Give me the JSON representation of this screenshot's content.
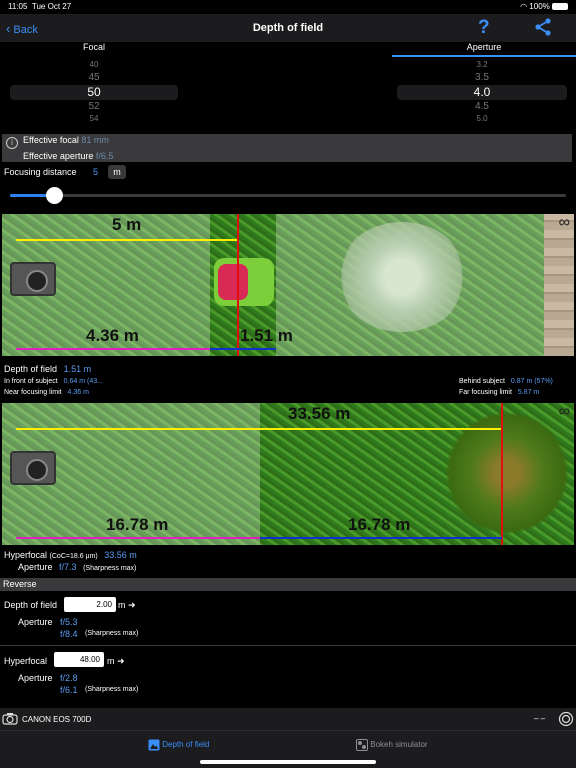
{
  "status": {
    "time": "11:05",
    "date": "Tue Oct 27",
    "battery": "100%"
  },
  "nav": {
    "back_label": "Back",
    "title": "Depth of field",
    "help_label": "?"
  },
  "segments": {
    "focal": "Focal",
    "aperture": "Aperture"
  },
  "focal_picker": {
    "rows": [
      "40",
      "45",
      "50",
      "52",
      "54"
    ],
    "selected": "50"
  },
  "aperture_picker": {
    "rows": [
      "3.2",
      "3.5",
      "4.0",
      "4.5",
      "5.0"
    ],
    "selected": "4.0"
  },
  "info": {
    "effective_focal_label": "Effective focal",
    "effective_focal_value": "81 mm",
    "effective_aperture_label": "Effective aperture",
    "effective_aperture_value": "f/6.5"
  },
  "focusing": {
    "label": "Focusing distance",
    "value": "5",
    "unit": "m",
    "slider_fraction": 0.08
  },
  "scene1": {
    "distance_label": "5 m",
    "near_label": "4.36 m",
    "dof_label": "1.51 m",
    "infinity": "∞"
  },
  "dof": {
    "label": "Depth of field",
    "value": "1.51 m",
    "front_label": "In front of subject",
    "front_value": "0.64 m (43...",
    "near_label": "Near focusing limit",
    "near_value": "4.36 m",
    "behind_label": "Behind subject",
    "behind_value": "0.87 m (57%)",
    "far_label": "Far focusing limit",
    "far_value": "5.87 m"
  },
  "scene2": {
    "hyperfocal_label": "33.56 m",
    "near_label": "16.78 m",
    "far_label": "16.78 m",
    "infinity": "∞"
  },
  "hyperfocal": {
    "label": "Hyperfocal",
    "coc": "(CoC=18.6 µm)",
    "value": "33.56 m",
    "aperture_label": "Aperture",
    "aperture_value": "f/7.3",
    "sharpness": "(Sharpness max)"
  },
  "reverse": {
    "header": "Reverse",
    "dof_label": "Depth of field",
    "dof_input": "2.00",
    "dof_unit": "m ➜",
    "dof_aperture_label": "Aperture",
    "dof_aperture_1": "f/5.3",
    "dof_aperture_2": "f/8.4",
    "dof_sharpness": "(Sharpness max)",
    "hyper_label": "Hyperfocal",
    "hyper_input": "48.00",
    "hyper_unit": "m ➜",
    "hyper_aperture_label": "Aperture",
    "hyper_aperture_1": "f/2.8",
    "hyper_aperture_2": "f/6.1",
    "hyper_sharpness": "(Sharpness max)"
  },
  "camera": {
    "name": "CANON EOS 700D",
    "dashes": "– –"
  },
  "tabs": {
    "dof": "Depth of field",
    "bokeh": "Bokeh simulator"
  },
  "colors": {
    "accent": "#3a8ef7",
    "yellow": "#ffee00",
    "magenta": "#e020c0",
    "blue_line": "#1030d0",
    "red": "#e01010"
  }
}
